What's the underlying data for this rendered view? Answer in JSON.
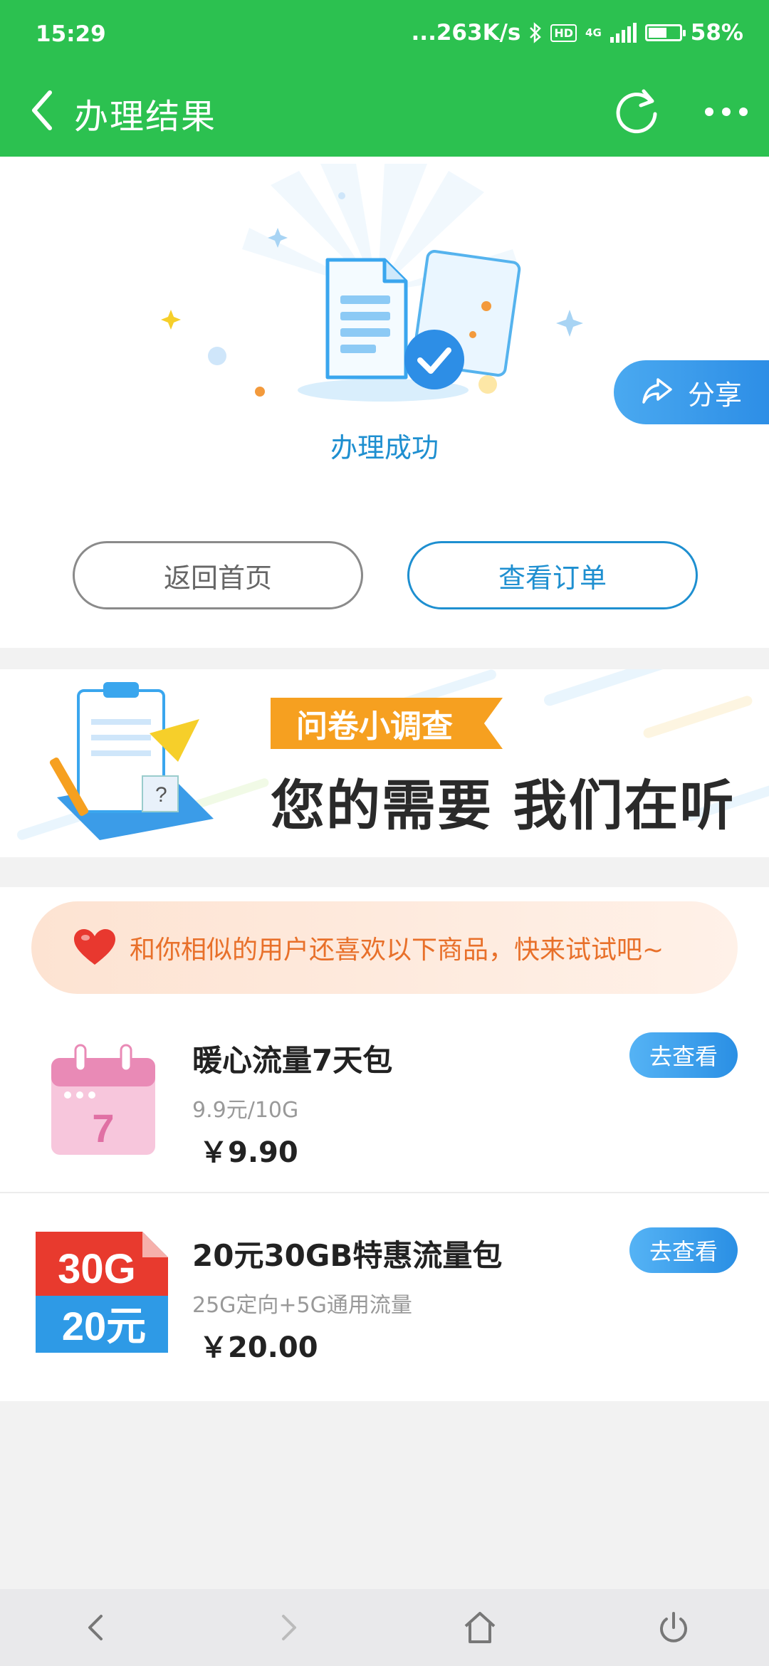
{
  "status_bar": {
    "time": "15:29",
    "network_speed": "...263K/s",
    "hd_badge": "HD",
    "network_type": "4G",
    "battery_percent": "58%",
    "battery_level": 0.58
  },
  "toolbar": {
    "title": "办理结果"
  },
  "result": {
    "status_text": "办理成功",
    "share_label": "分享",
    "home_button": "返回首页",
    "order_button": "查看订单"
  },
  "survey": {
    "tag": "问卷小调查",
    "headline": "您的需要 我们在听"
  },
  "recommend": {
    "banner_text": "和你相似的用户还喜欢以下商品，快来试试吧~",
    "products": [
      {
        "name": "暖心流量7天包",
        "desc": "9.9元/10G",
        "price": "￥9.90",
        "button": "去查看",
        "thumb_text": "7"
      },
      {
        "name": "20元30GB特惠流量包",
        "desc": "25G定向+5G通用流量",
        "price": "￥20.00",
        "button": "去查看",
        "thumb_top": "30G",
        "thumb_bottom": "20元"
      }
    ]
  },
  "colors": {
    "header_green": "#2cc150",
    "accent_blue": "#1e8fd0",
    "survey_orange": "#f6a020",
    "rec_text_orange": "#e8702a"
  }
}
